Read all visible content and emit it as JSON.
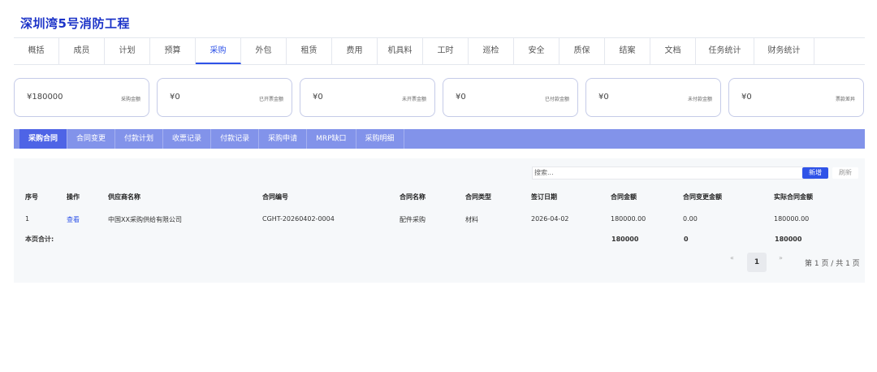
{
  "project_title": "深圳湾5号消防工程",
  "tabs": [
    "概括",
    "成员",
    "计划",
    "预算",
    "采购",
    "外包",
    "租赁",
    "费用",
    "机具料",
    "工时",
    "巡检",
    "安全",
    "质保",
    "结案",
    "文档",
    "任务统计",
    "财务统计"
  ],
  "active_tab": "采购",
  "cards": [
    {
      "value": "¥180000",
      "label": "采购金额"
    },
    {
      "value": "¥0",
      "label": "已开票金额"
    },
    {
      "value": "¥0",
      "label": "未开票金额"
    },
    {
      "value": "¥0",
      "label": "已付款金额"
    },
    {
      "value": "¥0",
      "label": "未付款金额"
    },
    {
      "value": "¥0",
      "label": "票款差异"
    }
  ],
  "subtabs": [
    "采购合同",
    "合同变更",
    "付款计划",
    "收票记录",
    "付款记录",
    "采购申请",
    "MRP缺口",
    "采购明细"
  ],
  "active_subtab": "采购合同",
  "search_placeholder": "搜索...",
  "add_button": "新增",
  "refresh_button": "刷新",
  "table": {
    "headers": [
      "序号",
      "操作",
      "供应商名称",
      "合同编号",
      "合同名称",
      "合同类型",
      "签订日期",
      "合同金额",
      "合同变更金额",
      "实际合同金额"
    ],
    "rows": [
      [
        "1",
        "查看",
        "中国XX采购供给有限公司",
        "CGHT-20260402-0004",
        "配件采购",
        "材料",
        "2026-04-02",
        "180000.00",
        "0.00",
        "180000.00"
      ]
    ],
    "summary_label": "本页合计:",
    "summary": {
      "contract_amount": "180000",
      "change_amount": "0",
      "actual_amount": "180000"
    }
  },
  "pagination": {
    "prev": "«",
    "current": "1",
    "next": "»",
    "info": "第 1 页 / 共 1 页"
  }
}
